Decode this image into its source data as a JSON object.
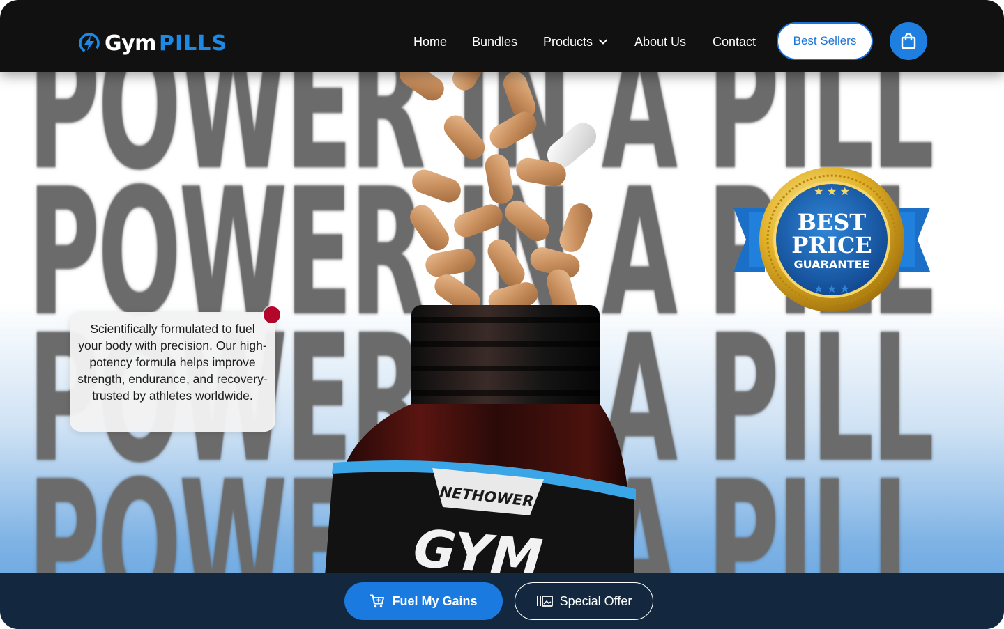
{
  "brand": {
    "name_part1": "Gym",
    "name_part2": "PILLS"
  },
  "nav": {
    "home": "Home",
    "bundles": "Bundles",
    "products": "Products",
    "about": "About Us",
    "contact": "Contact"
  },
  "header": {
    "best_sellers": "Best Sellers"
  },
  "hero": {
    "slogan": "POWER IN A PILL",
    "description": "Scientifically formulated to fuel your body with precision. Our high-potency formula helps improve strength, endurance, and recovery- trusted by athletes worldwide.",
    "product_brand": "NETHOWER",
    "product_name": "GYM"
  },
  "badge": {
    "line1": "BEST",
    "line2": "PRICE",
    "line3": "GUARANTEE"
  },
  "actions": {
    "primary": "Fuel My Gains",
    "secondary": "Special Offer"
  },
  "colors": {
    "accent": "#1e88e5",
    "header_bg": "#111111",
    "bottom_bar": "#13283f",
    "badge_gold": "#d9a91f",
    "badge_blue": "#1565c0"
  }
}
